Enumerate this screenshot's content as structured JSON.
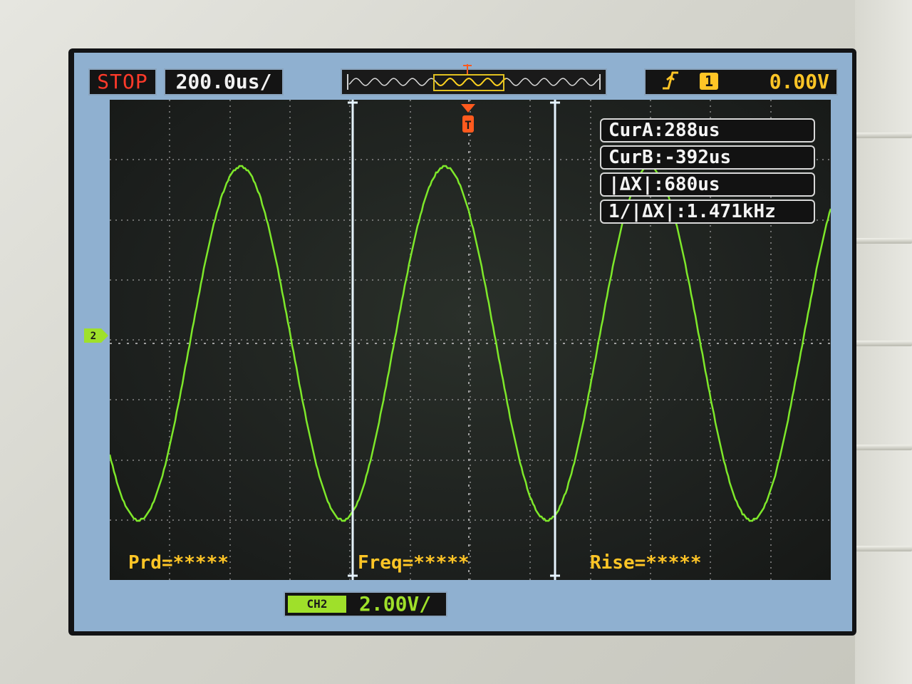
{
  "header": {
    "run_state": "STOP",
    "timebase": "200.0us/"
  },
  "trigger": {
    "edge_icon": "rising-edge-icon",
    "source": "1",
    "level": "0.00V"
  },
  "cursors": {
    "cur_a": "CurA:288us",
    "cur_b": "CurB:-392us",
    "delta": "|ΔX|:680us",
    "inverse_delta": "1/|ΔX|:1.471kHz"
  },
  "measurements": {
    "period": "Prd=*****",
    "frequency": "Freq=*****",
    "rise": "Rise=*****"
  },
  "channel": {
    "tag": "CH2",
    "marker": "2",
    "scale": "2.00V/",
    "trace_color": "#7ee82a"
  },
  "colors": {
    "stop": "#ff3a2a",
    "trigger": "#ffc526",
    "cursor_line": "#e6f4ff",
    "trigger_marker": "#ff5a1e"
  }
}
